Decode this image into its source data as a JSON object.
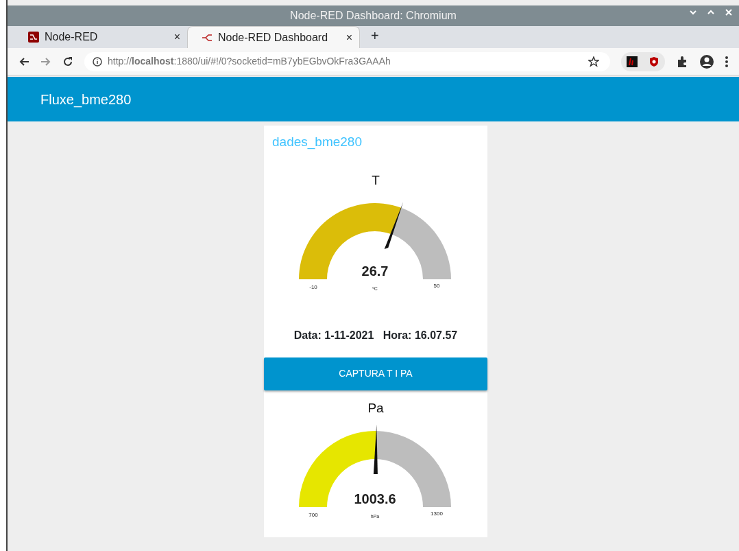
{
  "window": {
    "title": "Node-RED Dashboard: Chromium"
  },
  "tabs": [
    {
      "label": "Node-RED",
      "selected": false,
      "close": "×"
    },
    {
      "label": "Node-RED Dashboard",
      "selected": true,
      "close": "×"
    }
  ],
  "new_tab": "+",
  "address_bar": {
    "url": "http://**localhost**:1880/ui/#!/0?socketid=mB7ybEGbvOkFra3GAAAh"
  },
  "header": {
    "title": "Fluxe_bme280"
  },
  "group": {
    "title": "dades_bme280"
  },
  "widgets": [
    {
      "kind": "gauge",
      "label": "T",
      "value": "26.7",
      "unit": "ºC",
      "min": "-10",
      "max": "50",
      "color": "#dbbd09"
    },
    {
      "kind": "text",
      "text": "Data: 1-11-2021   Hora: 16.07.57"
    },
    {
      "kind": "button",
      "label": "CAPTURA T I PA"
    },
    {
      "kind": "gauge",
      "label": "Pa",
      "value": "1003.6",
      "unit": "hPa",
      "min": "700",
      "max": "1300",
      "color": "#e6e600"
    }
  ]
}
